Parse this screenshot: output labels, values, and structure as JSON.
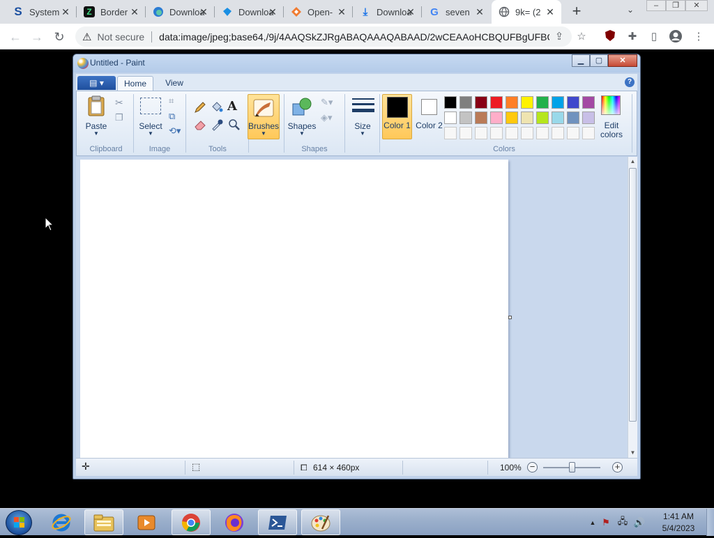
{
  "browser": {
    "tabs": [
      {
        "title": "System",
        "favicon": "S"
      },
      {
        "title": "Border",
        "favicon": "Z"
      },
      {
        "title": "Download",
        "favicon": "edge-icon"
      },
      {
        "title": "Download",
        "favicon": "dropbox-icon"
      },
      {
        "title": "Open-",
        "favicon": "git-icon"
      },
      {
        "title": "Download",
        "favicon": "download-icon"
      },
      {
        "title": "seven",
        "favicon": "G"
      },
      {
        "title": "9k= (2",
        "favicon": "globe-icon"
      }
    ],
    "security_label": "Not secure",
    "url": "data:image/jpeg;base64,/9j/4AAQSkZJRgABAQAAAQABAAD/2wCEAAoHCBQUFBgUFBQ..."
  },
  "paint": {
    "title": "Untitled - Paint",
    "menu": {
      "file": "▤ ▾",
      "home": "Home",
      "view": "View"
    },
    "ribbon": {
      "paste": "Paste",
      "select": "Select",
      "brushes": "Brushes",
      "shapes": "Shapes",
      "size": "Size",
      "color1": "Color 1",
      "color2": "Color 2",
      "edit_colors": "Edit colors",
      "groups": {
        "clipboard": "Clipboard",
        "image": "Image",
        "tools": "Tools",
        "shapes": "Shapes",
        "colors": "Colors"
      }
    },
    "palette": {
      "row1": [
        "#000000",
        "#7f7f7f",
        "#880015",
        "#ed1c24",
        "#ff7f27",
        "#fff200",
        "#22b14c",
        "#00a2e8",
        "#3f48cc",
        "#a349a4"
      ],
      "row2": [
        "#ffffff",
        "#c3c3c3",
        "#b97a57",
        "#ffaec9",
        "#ffc90e",
        "#efe4b0",
        "#b5e61d",
        "#99d9ea",
        "#7092be",
        "#c8bfe7"
      ]
    },
    "color1_value": "#000000",
    "color2_value": "#ffffff",
    "status": {
      "canvas_size": "614 × 460px",
      "zoom": "100%"
    }
  },
  "taskbar": {
    "time": "1:41 AM",
    "date": "5/4/2023"
  }
}
